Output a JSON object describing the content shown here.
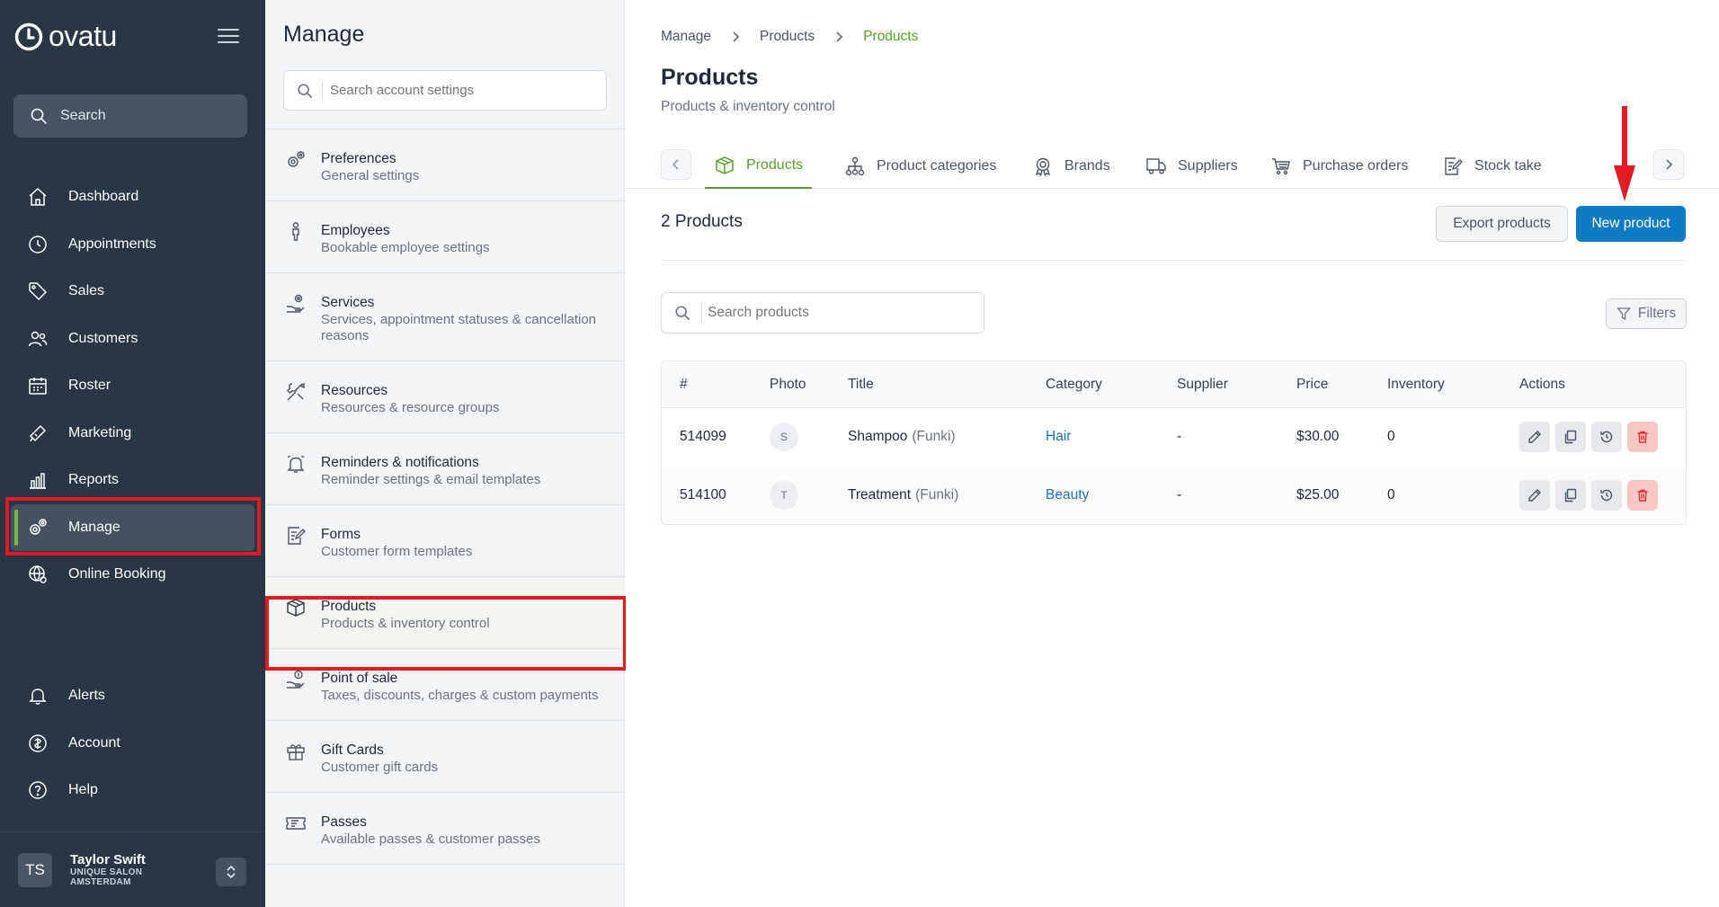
{
  "brand": {
    "logo_text": "ovatu"
  },
  "nav": {
    "search_label": "Search",
    "items": [
      {
        "label": "Dashboard",
        "icon": "home-icon"
      },
      {
        "label": "Appointments",
        "icon": "clock-icon"
      },
      {
        "label": "Sales",
        "icon": "tag-icon"
      },
      {
        "label": "Customers",
        "icon": "users-icon"
      },
      {
        "label": "Roster",
        "icon": "calendar-icon"
      },
      {
        "label": "Marketing",
        "icon": "megaphone-icon"
      },
      {
        "label": "Reports",
        "icon": "bar-chart-icon"
      },
      {
        "label": "Manage",
        "icon": "gears-icon"
      },
      {
        "label": "Online Booking",
        "icon": "globe-gear-icon"
      }
    ],
    "bottom_items": [
      {
        "label": "Alerts",
        "icon": "bell-icon"
      },
      {
        "label": "Account",
        "icon": "account-icon"
      },
      {
        "label": "Help",
        "icon": "help-icon"
      }
    ],
    "user": {
      "initials": "TS",
      "name": "Taylor Swift",
      "salon_line1": "UNIQUE SALON",
      "salon_line2": "AMSTERDAM"
    }
  },
  "settings": {
    "title": "Manage",
    "search_placeholder": "Search account settings",
    "items": [
      {
        "title": "Preferences",
        "sub": "General settings"
      },
      {
        "title": "Employees",
        "sub": "Bookable employee settings"
      },
      {
        "title": "Services",
        "sub": "Services, appointment statuses & cancellation reasons"
      },
      {
        "title": "Resources",
        "sub": "Resources & resource groups"
      },
      {
        "title": "Reminders & notifications",
        "sub": "Reminder settings & email templates"
      },
      {
        "title": "Forms",
        "sub": "Customer form templates"
      },
      {
        "title": "Products",
        "sub": "Products & inventory control"
      },
      {
        "title": "Point of sale",
        "sub": "Taxes, discounts, charges & custom payments"
      },
      {
        "title": "Gift Cards",
        "sub": "Customer gift cards"
      },
      {
        "title": "Passes",
        "sub": "Available passes & customer passes"
      }
    ]
  },
  "main": {
    "breadcrumb": [
      "Manage",
      "Products",
      "Products"
    ],
    "title": "Products",
    "subtitle": "Products & inventory control",
    "tabs": [
      {
        "label": "Products",
        "icon": "box-icon"
      },
      {
        "label": "Product categories",
        "icon": "hierarchy-icon"
      },
      {
        "label": "Brands",
        "icon": "award-icon"
      },
      {
        "label": "Suppliers",
        "icon": "truck-icon"
      },
      {
        "label": "Purchase orders",
        "icon": "cart-icon"
      },
      {
        "label": "Stock take",
        "icon": "clipboard-icon"
      }
    ],
    "count_title": "2 Products",
    "export_label": "Export products",
    "new_label": "New product",
    "search_placeholder": "Search products",
    "filters_label": "Filters",
    "columns": [
      "#",
      "Photo",
      "Title",
      "Category",
      "Supplier",
      "Price",
      "Inventory",
      "Actions"
    ],
    "rows": [
      {
        "id": "514099",
        "photo": "S",
        "title": "Shampoo",
        "brand": "(Funki)",
        "category": "Hair",
        "supplier": "-",
        "price": "$30.00",
        "inventory": "0"
      },
      {
        "id": "514100",
        "photo": "T",
        "title": "Treatment",
        "brand": "(Funki)",
        "category": "Beauty",
        "supplier": "-",
        "price": "$25.00",
        "inventory": "0"
      }
    ]
  },
  "colors": {
    "nav_bg": "#2b3644",
    "accent_green": "#5aa02c",
    "primary_blue": "#0f7bc4",
    "highlight_red": "#e01b24"
  }
}
